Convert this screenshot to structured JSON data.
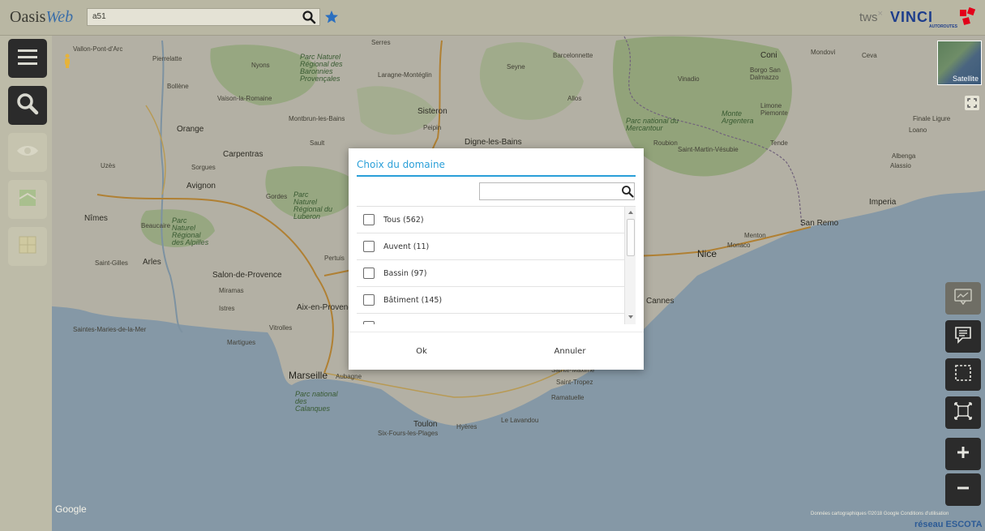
{
  "header": {
    "logo_main": "Oasis",
    "logo_suffix": "Web",
    "search_value": "a51",
    "tws_label": "tws",
    "tws_mark": "×",
    "vinci_brand": "VINCI",
    "vinci_sub": "AUTOROUTES"
  },
  "map": {
    "labels": [
      "Vallon-Pont-d'Arc",
      "Pierrelatte",
      "Nyons",
      "Parc Naturel Régional des Baronnies Provençales",
      "Serres",
      "Laragne-Montéglin",
      "Seyne",
      "Barcelonnette",
      "Coni",
      "Mondovì",
      "Ceva",
      "Borgo San Dalmazzo",
      "Vinadio",
      "Bollène",
      "Vaison-la-Romaine",
      "Sisteron",
      "Allos",
      "Limone Piemonte",
      "Finale Ligure",
      "Monte Argentera",
      "Loano",
      "Orange",
      "Montbrun-les-Bains",
      "Peipin",
      "Parc national du Mercantour",
      "Sault",
      "Digne-les-Bains",
      "Roubion",
      "Saint-Martin-Vésubie",
      "Tende",
      "Albenga",
      "Alassio",
      "Carpentras",
      "Uzès",
      "Sorgues",
      "Avignon",
      "Gordes",
      "Parc Naturel Régional du Luberon",
      "Imperia",
      "Nîmes",
      "Beaucaire",
      "Parc Naturel Régional des Alpilles",
      "San Remo",
      "Menton",
      "Monaco",
      "Nice",
      "Saint-Gilles",
      "Arles",
      "Pertuis",
      "Salon-de-Provence",
      "Miramas",
      "Istres",
      "Aix-en-Provence",
      "Cannes",
      "Saintes-Maries-de-la-Mer",
      "Vitrolles",
      "Martigues",
      "Marseille",
      "Aubagne",
      "Parc national des Calanques",
      "Sainte-Maxime",
      "Saint-Tropez",
      "Ramatuelle",
      "Le Lavandou",
      "Toulon",
      "Hyères",
      "Six-Fours-les-Plages"
    ],
    "google_logo": "Google",
    "attribution": "Données cartographiques ©2018 Google   Conditions d'utilisation",
    "satellite_label": "Satellite",
    "network_label": "réseau ESCOTA"
  },
  "sidebar": {
    "items": [
      {
        "icon": "menu-icon"
      },
      {
        "icon": "search-icon"
      },
      {
        "icon": "eye-icon"
      },
      {
        "icon": "layers-icon"
      },
      {
        "icon": "grid-icon"
      }
    ]
  },
  "controls": {
    "items": [
      {
        "icon": "chart-icon"
      },
      {
        "icon": "comment-icon"
      },
      {
        "icon": "select-area-icon"
      },
      {
        "icon": "fit-extent-icon"
      },
      {
        "icon": "zoom-in-icon"
      },
      {
        "icon": "zoom-out-icon"
      }
    ]
  },
  "modal": {
    "title": "Choix du domaine",
    "filter_value": "",
    "items": [
      {
        "label": "Tous (562)",
        "checked": false
      },
      {
        "label": "Auvent (11)",
        "checked": false
      },
      {
        "label": "Bassin (97)",
        "checked": false
      },
      {
        "label": "Bâtiment (145)",
        "checked": false
      }
    ],
    "ok_label": "Ok",
    "cancel_label": "Annuler"
  },
  "colors": {
    "accent": "#2a9fd8",
    "vinci_blue": "#1d3d8c",
    "vinci_red": "#e2001a",
    "sea": "#aac4dc",
    "land": "#e9e5d8",
    "park": "#c2d8a8"
  }
}
